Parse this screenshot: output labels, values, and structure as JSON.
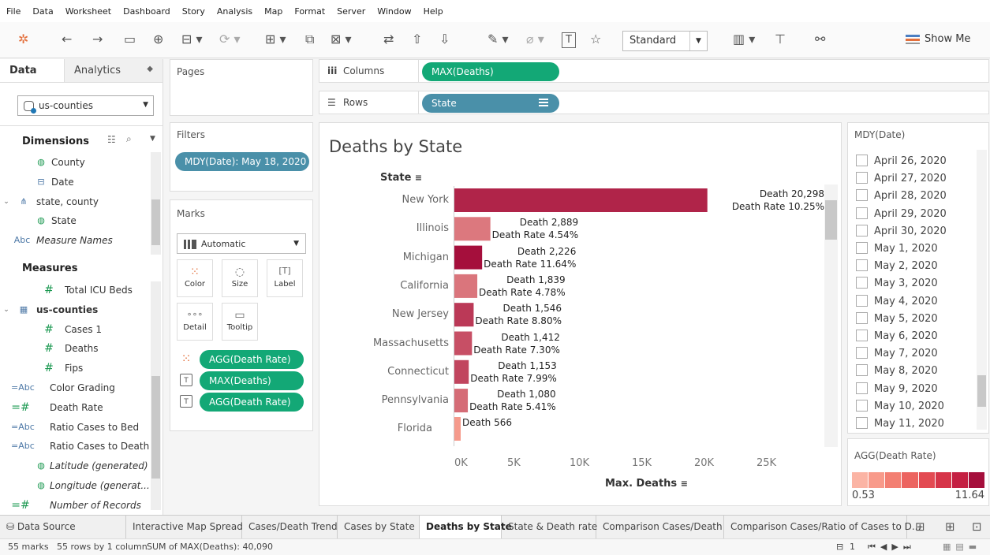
{
  "menu": [
    "File",
    "Data",
    "Worksheet",
    "Dashboard",
    "Story",
    "Analysis",
    "Map",
    "Format",
    "Server",
    "Window",
    "Help"
  ],
  "toolbar": {
    "fit_select": "Standard",
    "show_me": "Show Me"
  },
  "data_pane": {
    "tab_data": "Data",
    "tab_analytics": "Analytics",
    "datasource": "us-counties",
    "dimensions_title": "Dimensions",
    "dimensions": [
      {
        "icon": "globe",
        "label": "County"
      },
      {
        "icon": "date",
        "label": "Date"
      },
      {
        "icon": "hierarchy",
        "label": "state, county"
      },
      {
        "icon": "globe",
        "label": "State"
      },
      {
        "icon": "abc",
        "label": "Measure Names"
      }
    ],
    "measures_title": "Measures",
    "measures": [
      {
        "icon": "#",
        "label": "Total ICU Beds"
      },
      {
        "icon": "table",
        "label": "us-counties"
      },
      {
        "icon": "#",
        "label": "Cases 1"
      },
      {
        "icon": "#",
        "label": "Deaths"
      },
      {
        "icon": "#",
        "label": "Fips"
      },
      {
        "icon": "=Abc",
        "label": "Color Grading"
      },
      {
        "icon": "=#",
        "label": "Death Rate"
      },
      {
        "icon": "=Abc",
        "label": "Ratio Cases to Bed"
      },
      {
        "icon": "=Abc",
        "label": "Ratio Cases to Death"
      },
      {
        "icon": "globe",
        "label": "Latitude (generated)"
      },
      {
        "icon": "globe",
        "label": "Longitude (generat..."
      },
      {
        "icon": "=#",
        "label": "Number of Records"
      }
    ],
    "icon_glyphs": {
      "abc": "Abc",
      "date": "⊟",
      "hierarchy": "⋔",
      "table": "▦"
    }
  },
  "shelves": {
    "pages_title": "Pages",
    "filters_title": "Filters",
    "filter_pill": "MDY(Date): May 18, 2020",
    "marks_title": "Marks",
    "marks_type": "Automatic",
    "mark_buttons": {
      "color": "Color",
      "size": "Size",
      "label": "Label",
      "detail": "Detail",
      "tooltip": "Tooltip"
    },
    "mark_pills": [
      "AGG(Death Rate)",
      "MAX(Deaths)",
      "AGG(Death Rate)"
    ],
    "columns_label": "Columns",
    "columns_pill": "MAX(Deaths)",
    "rows_label": "Rows",
    "rows_pill": "State"
  },
  "view": {
    "title": "Deaths by State",
    "row_header_title": "State",
    "axis_title": "Max. Deaths",
    "death_prefix": "Death ",
    "rate_prefix": "Death Rate ",
    "partial_row": {
      "state": "Florida",
      "label": "Death 566"
    }
  },
  "chart_data": {
    "type": "bar",
    "orientation": "horizontal",
    "title": "Deaths by State",
    "xlabel": "Max. Deaths",
    "ylabel": "State",
    "xlim": [
      0,
      29000
    ],
    "xticks": [
      0,
      5000,
      10000,
      15000,
      20000,
      25000
    ],
    "xtick_labels": [
      "0K",
      "5K",
      "10K",
      "15K",
      "20K",
      "25K"
    ],
    "categories": [
      "New York",
      "Illinois",
      "Michigan",
      "California",
      "New Jersey",
      "Massachusetts",
      "Connecticut",
      "Pennsylvania"
    ],
    "values": [
      20298,
      2889,
      2226,
      1839,
      1546,
      1412,
      1153,
      1080
    ],
    "value_labels": [
      "20,298",
      "2,889",
      "2,226",
      "1,839",
      "1,546",
      "1,412",
      "1,153",
      "1,080"
    ],
    "death_rate_labels": [
      "10.25%",
      "4.54%",
      "11.64%",
      "4.78%",
      "8.80%",
      "7.30%",
      "7.99%",
      "5.41%"
    ],
    "death_rate": [
      10.25,
      4.54,
      11.64,
      4.78,
      8.8,
      7.3,
      7.99,
      5.41
    ],
    "color_scale": {
      "measure": "AGG(Death Rate)",
      "min": 0.53,
      "max": 11.64,
      "low_color": "#fbb4a4",
      "high_color": "#a50f3c"
    }
  },
  "date_filter": {
    "title": "MDY(Date)",
    "items": [
      "April 26, 2020",
      "April 27, 2020",
      "April 28, 2020",
      "April 29, 2020",
      "April 30, 2020",
      "May 1, 2020",
      "May 2, 2020",
      "May 3, 2020",
      "May 4, 2020",
      "May 5, 2020",
      "May 6, 2020",
      "May 7, 2020",
      "May 8, 2020",
      "May 9, 2020",
      "May 10, 2020",
      "May 11, 2020"
    ]
  },
  "legend": {
    "title": "AGG(Death Rate)",
    "min_label": "0.53",
    "max_label": "11.64",
    "swatches": [
      "#fbb4a4",
      "#f89a8a",
      "#f37f72",
      "#ec6460",
      "#e34a52",
      "#d63448",
      "#c41f42",
      "#a50f3c"
    ]
  },
  "tabs": {
    "data_source": "Data Source",
    "sheets": [
      "Interactive Map Spread",
      "Cases/Death Trend",
      "Cases by State",
      "Deaths by State",
      "State & Death rate",
      "Comparison Cases/Death",
      "Comparison Cases/Ratio of Cases to D..."
    ],
    "active": "Deaths by State"
  },
  "status": {
    "marks": "55 marks",
    "rows": "55 rows by 1 column",
    "sum": "SUM of MAX(Deaths): 40,090",
    "page": "1"
  }
}
